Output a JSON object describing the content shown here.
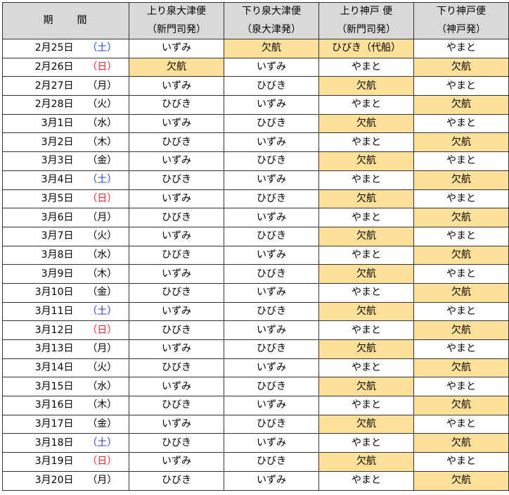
{
  "header": {
    "period": "期　間",
    "columns": [
      {
        "line1": "上り泉大津便",
        "line2": "（新門司発）"
      },
      {
        "line1": "下り泉大津便",
        "line2": "（泉大津発）"
      },
      {
        "line1": "上り神戸 便",
        "line2": "（新門司発）"
      },
      {
        "line1": "下り神戸便",
        "line2": "（神戸発）"
      }
    ]
  },
  "colors": {
    "highlight": "#ffe099",
    "saturday": "#1f3fd6",
    "sunday": "#e0262c",
    "header_bg": "#d9d9d9"
  },
  "rows": [
    {
      "date": "2月25日",
      "dow": "（土）",
      "cells": [
        "いずみ",
        "欠航",
        "ひびき（代船）",
        "やまと"
      ]
    },
    {
      "date": "2月26日",
      "dow": "（日）",
      "cells": [
        "欠航",
        "いずみ",
        "やまと",
        "欠航"
      ]
    },
    {
      "date": "2月27日",
      "dow": "（月）",
      "cells": [
        "いずみ",
        "ひびき",
        "欠航",
        "やまと"
      ]
    },
    {
      "date": "2月28日",
      "dow": "（火）",
      "cells": [
        "ひびき",
        "いずみ",
        "やまと",
        "欠航"
      ]
    },
    {
      "date": "3月1日",
      "dow": "（水）",
      "cells": [
        "いずみ",
        "ひびき",
        "欠航",
        "やまと"
      ]
    },
    {
      "date": "3月2日",
      "dow": "（木）",
      "cells": [
        "ひびき",
        "いずみ",
        "やまと",
        "欠航"
      ]
    },
    {
      "date": "3月3日",
      "dow": "（金）",
      "cells": [
        "いずみ",
        "ひびき",
        "欠航",
        "やまと"
      ]
    },
    {
      "date": "3月4日",
      "dow": "（土）",
      "cells": [
        "ひびき",
        "いずみ",
        "やまと",
        "欠航"
      ]
    },
    {
      "date": "3月5日",
      "dow": "（日）",
      "cells": [
        "いずみ",
        "ひびき",
        "欠航",
        "やまと"
      ]
    },
    {
      "date": "3月6日",
      "dow": "（月）",
      "cells": [
        "ひびき",
        "いずみ",
        "やまと",
        "欠航"
      ]
    },
    {
      "date": "3月7日",
      "dow": "（火）",
      "cells": [
        "いずみ",
        "ひびき",
        "欠航",
        "やまと"
      ]
    },
    {
      "date": "3月8日",
      "dow": "（水）",
      "cells": [
        "ひびき",
        "いずみ",
        "やまと",
        "欠航"
      ]
    },
    {
      "date": "3月9日",
      "dow": "（木）",
      "cells": [
        "いずみ",
        "ひびき",
        "欠航",
        "やまと"
      ]
    },
    {
      "date": "3月10日",
      "dow": "（金）",
      "cells": [
        "ひびき",
        "いずみ",
        "やまと",
        "欠航"
      ]
    },
    {
      "date": "3月11日",
      "dow": "（土）",
      "cells": [
        "いずみ",
        "ひびき",
        "欠航",
        "やまと"
      ]
    },
    {
      "date": "3月12日",
      "dow": "（日）",
      "cells": [
        "ひびき",
        "いずみ",
        "やまと",
        "欠航"
      ]
    },
    {
      "date": "3月13日",
      "dow": "（月）",
      "cells": [
        "いずみ",
        "ひびき",
        "欠航",
        "やまと"
      ]
    },
    {
      "date": "3月14日",
      "dow": "（火）",
      "cells": [
        "ひびき",
        "いずみ",
        "やまと",
        "欠航"
      ]
    },
    {
      "date": "3月15日",
      "dow": "（水）",
      "cells": [
        "いずみ",
        "ひびき",
        "欠航",
        "やまと"
      ]
    },
    {
      "date": "3月16日",
      "dow": "（木）",
      "cells": [
        "ひびき",
        "いずみ",
        "やまと",
        "欠航"
      ]
    },
    {
      "date": "3月17日",
      "dow": "（金）",
      "cells": [
        "いずみ",
        "ひびき",
        "欠航",
        "やまと"
      ]
    },
    {
      "date": "3月18日",
      "dow": "（土）",
      "cells": [
        "ひびき",
        "いずみ",
        "やまと",
        "欠航"
      ]
    },
    {
      "date": "3月19日",
      "dow": "（日）",
      "cells": [
        "いずみ",
        "ひびき",
        "欠航",
        "やまと"
      ]
    },
    {
      "date": "3月20日",
      "dow": "（月）",
      "cells": [
        "ひびき",
        "いずみ",
        "やまと",
        "欠航"
      ]
    }
  ]
}
